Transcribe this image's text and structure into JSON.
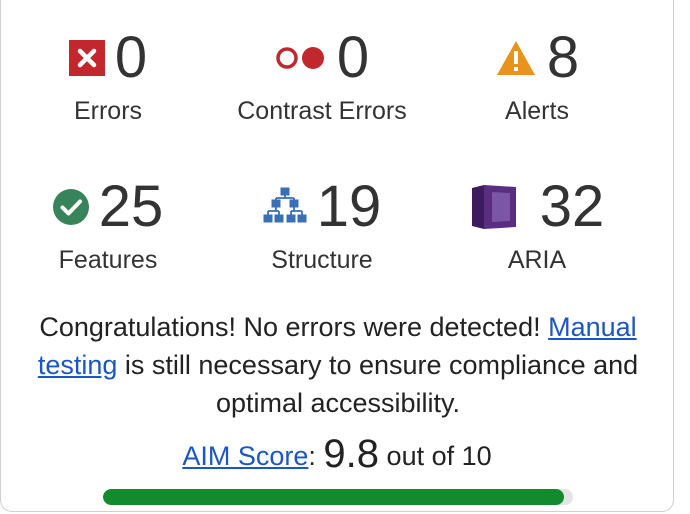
{
  "stats": {
    "errors": {
      "count": "0",
      "label": "Errors"
    },
    "contrast_errors": {
      "count": "0",
      "label": "Contrast Errors"
    },
    "alerts": {
      "count": "8",
      "label": "Alerts"
    },
    "features": {
      "count": "25",
      "label": "Features"
    },
    "structure": {
      "count": "19",
      "label": "Structure"
    },
    "aria": {
      "count": "32",
      "label": "ARIA"
    }
  },
  "message": {
    "before_link": "Congratulations! No errors were detected! ",
    "link_text": "Manual testing",
    "after_link": " is still necessary to ensure compliance and optimal accessibility."
  },
  "score": {
    "link_text": "AIM Score",
    "separator": ":",
    "value": "9.8",
    "suffix": "out of 10",
    "fraction": 0.98
  },
  "colors": {
    "error_red": "#c2272d",
    "alert_orange": "#e8931c",
    "feature_green": "#37845a",
    "structure_blue": "#3a6fb5",
    "aria_purple": "#5a2d82",
    "progress_green": "#138a2e",
    "link_blue": "#1a57c4"
  },
  "icons": {
    "errors": "error-x-icon",
    "contrast_errors": "contrast-circles-icon",
    "alerts": "warning-triangle-icon",
    "features": "check-circle-icon",
    "structure": "hierarchy-icon",
    "aria": "aria-box-icon"
  }
}
